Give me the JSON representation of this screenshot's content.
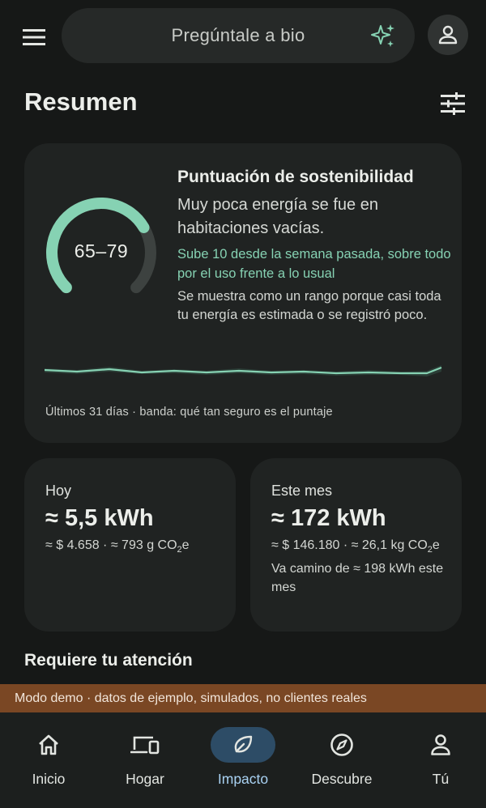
{
  "search": {
    "placeholder": "Pregúntale a bio"
  },
  "summary": {
    "title": "Resumen"
  },
  "score_card": {
    "range": "65–79",
    "gauge_fill": 0.72,
    "title": "Puntuación de sostenibilidad",
    "description": "Muy poca energía se fue en habitaciones vacías.",
    "change": "Sube 10 desde la semana pasada, sobre todo por el uso frente a lo usual",
    "note": "Se muestra como un rango porque casi toda tu energía es estimada o se registró poco.",
    "caption": "Últimos 31 días · banda: qué tan seguro es el puntaje"
  },
  "today": {
    "label": "Hoy",
    "value": "≈ 5,5 kWh",
    "detail_cost": "≈ $ 4.658 · ≈ 793 g CO",
    "detail_sub": "2",
    "detail_suffix": "e"
  },
  "month": {
    "label": "Este mes",
    "value": "≈ 172 kWh",
    "detail_cost": "≈ $ 146.180 · ≈ 26,1 kg CO",
    "detail_sub": "2",
    "detail_suffix": "e",
    "projection": "Va camino de ≈ 198 kWh este mes"
  },
  "attention": {
    "title": "Requiere tu atención"
  },
  "banner": {
    "text": "Modo demo · datos de ejemplo, simulados, no clientes reales"
  },
  "nav": {
    "items": [
      {
        "label": "Inicio",
        "icon": "home-icon"
      },
      {
        "label": "Hogar",
        "icon": "devices-icon"
      },
      {
        "label": "Impacto",
        "icon": "leaf-icon",
        "active": true
      },
      {
        "label": "Descubre",
        "icon": "compass-icon"
      },
      {
        "label": "Tú",
        "icon": "person-icon"
      }
    ]
  },
  "colors": {
    "accent_teal": "#86d2b3",
    "active_nav": "#2d4c66",
    "banner": "#7a4724",
    "card": "#202322",
    "background": "#161817"
  }
}
